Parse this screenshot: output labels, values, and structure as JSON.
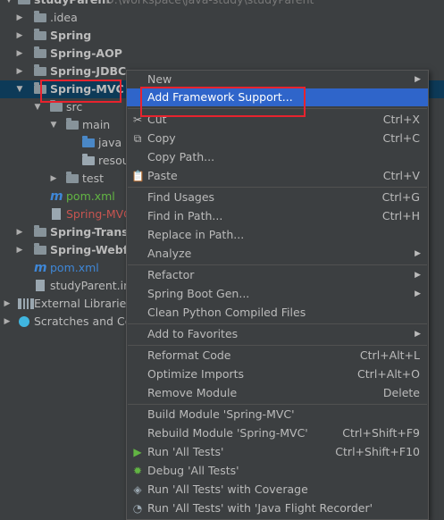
{
  "tree": {
    "root_name": "studyParent",
    "root_path": "D:\\workspace\\java-study\\studyParent",
    "items": [
      {
        "label": ".idea"
      },
      {
        "label": "Spring"
      },
      {
        "label": "Spring-AOP"
      },
      {
        "label": "Spring-JDBC"
      },
      {
        "label": "Spring-MVC"
      },
      {
        "label": "src"
      },
      {
        "label": "main"
      },
      {
        "label": "java"
      },
      {
        "label": "resou"
      },
      {
        "label": "test"
      },
      {
        "label": "pom.xml"
      },
      {
        "label": "Spring-MVC"
      },
      {
        "label": "Spring-Transa"
      },
      {
        "label": "Spring-Webflu"
      },
      {
        "label": "pom.xml"
      },
      {
        "label": "studyParent.im"
      },
      {
        "label": "External Libraries"
      },
      {
        "label": "Scratches and Co"
      }
    ]
  },
  "menu": {
    "items": [
      {
        "label": "New",
        "shortcut": ""
      },
      {
        "label": "Add Framework Support...",
        "shortcut": ""
      },
      {
        "label": "Cut",
        "shortcut": "Ctrl+X"
      },
      {
        "label": "Copy",
        "shortcut": "Ctrl+C"
      },
      {
        "label": "Copy Path...",
        "shortcut": ""
      },
      {
        "label": "Paste",
        "shortcut": "Ctrl+V"
      },
      {
        "label": "Find Usages",
        "shortcut": "Ctrl+G"
      },
      {
        "label": "Find in Path...",
        "shortcut": "Ctrl+H"
      },
      {
        "label": "Replace in Path...",
        "shortcut": ""
      },
      {
        "label": "Analyze",
        "shortcut": ""
      },
      {
        "label": "Refactor",
        "shortcut": ""
      },
      {
        "label": "Spring Boot Gen...",
        "shortcut": ""
      },
      {
        "label": "Clean Python Compiled Files",
        "shortcut": ""
      },
      {
        "label": "Add to Favorites",
        "shortcut": ""
      },
      {
        "label": "Reformat Code",
        "shortcut": "Ctrl+Alt+L"
      },
      {
        "label": "Optimize Imports",
        "shortcut": "Ctrl+Alt+O"
      },
      {
        "label": "Remove Module",
        "shortcut": "Delete"
      },
      {
        "label": "Build Module 'Spring-MVC'",
        "shortcut": ""
      },
      {
        "label": "Rebuild Module 'Spring-MVC'",
        "shortcut": "Ctrl+Shift+F9"
      },
      {
        "label": "Run 'All Tests'",
        "shortcut": "Ctrl+Shift+F10"
      },
      {
        "label": "Debug 'All Tests'",
        "shortcut": ""
      },
      {
        "label": "Run 'All Tests' with Coverage",
        "shortcut": ""
      },
      {
        "label": "Run 'All Tests' with 'Java Flight Recorder'",
        "shortcut": ""
      }
    ]
  },
  "colors": {
    "background": "#3c3f41",
    "selection": "#0d3a58",
    "menu_highlight": "#2f65ca",
    "annotation_red": "#e8232e",
    "maven_blue": "#3f87d7",
    "warning_red": "#c75450",
    "green": "#62b543"
  }
}
